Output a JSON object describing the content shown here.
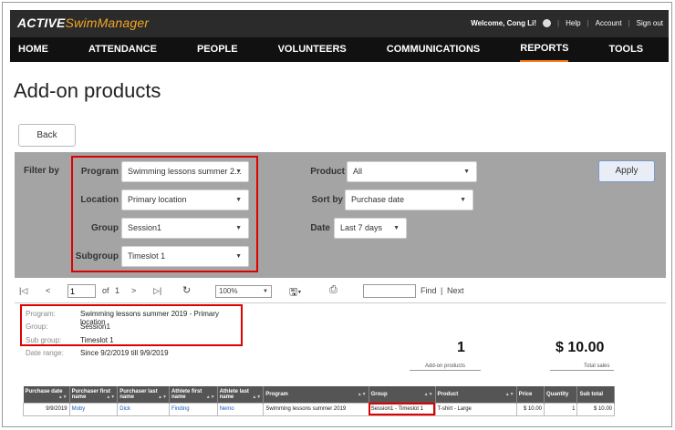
{
  "app": {
    "logo_active": "ACTIVE",
    "logo_product": "SwimManager"
  },
  "utility": {
    "welcome": "Welcome, Cong Li!",
    "help": "Help",
    "account": "Account",
    "signout": "Sign out"
  },
  "nav": [
    "HOME",
    "ATTENDANCE",
    "PEOPLE",
    "VOLUNTEERS",
    "COMMUNICATIONS",
    "REPORTS",
    "TOOLS"
  ],
  "page": {
    "title": "Add-on products",
    "back": "Back"
  },
  "filters": {
    "filter_by": "Filter by",
    "program_label": "Program",
    "program_value": "Swimming lessons summer 2...",
    "location_label": "Location",
    "location_value": "Primary location",
    "group_label": "Group",
    "group_value": "Session1",
    "subgroup_label": "Subgroup",
    "subgroup_value": "Timeslot 1",
    "product_label": "Product",
    "product_value": "All",
    "sortby_label": "Sort by",
    "sortby_value": "Purchase date",
    "date_label": "Date",
    "date_value": "Last 7 days",
    "apply": "Apply"
  },
  "toolbar": {
    "page": "1",
    "of": "of",
    "total_pages": "1",
    "zoom": "100%",
    "find": "Find",
    "separator": "|",
    "next": "Next"
  },
  "report_info": {
    "program_k": "Program:",
    "program_v": "Swimming lessons summer 2019 - Primary location",
    "group_k": "Group:",
    "group_v": "Session1",
    "subgroup_k": "Sub group:",
    "subgroup_v": "Timeslot 1",
    "daterange_k": "Date range:",
    "daterange_v": "Since 9/2/2019 till 9/9/2019"
  },
  "stats": {
    "count": "1",
    "count_caption": "Add-on products",
    "sales": "$ 10.00",
    "sales_caption": "Total sales"
  },
  "table": {
    "headers": [
      "Purchase date",
      "Purchaser first name",
      "Purchaser last name",
      "Athlete first name",
      "Athlete last name",
      "Program",
      "Group",
      "Product",
      "Price",
      "Quantity",
      "Sub total"
    ],
    "row": [
      "9/9/2019",
      "Moby",
      "Dick",
      "Finding",
      "Nemo",
      "Swimming lessons summer 2019",
      "Session1 - Timeslot 1",
      "T-shirt - Large",
      "$ 10.00",
      "1",
      "$ 10.00"
    ]
  },
  "colors": {
    "accent": "#ff7a1a",
    "highlight": "#e00000",
    "filter_bg": "#a4a4a4"
  }
}
